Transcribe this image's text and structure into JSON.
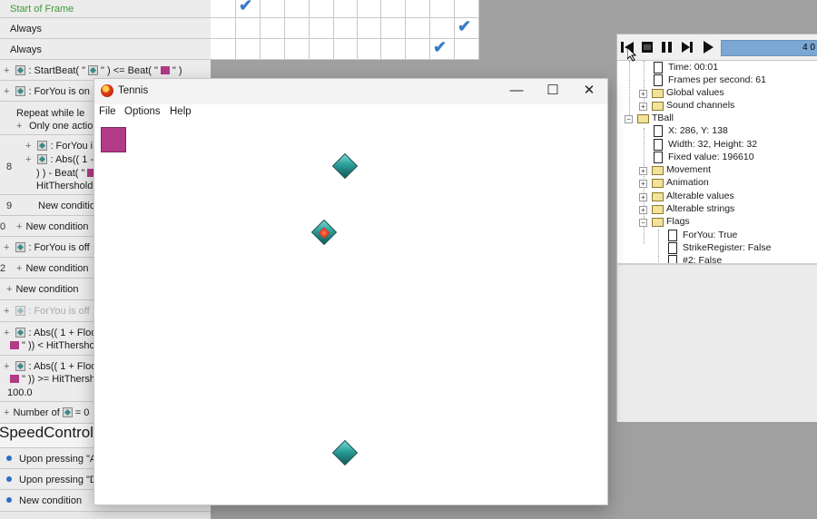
{
  "editor": {
    "rows": [
      {
        "num": "",
        "parts": [
          "Start of Frame"
        ],
        "style": "green"
      },
      {
        "num": "",
        "parts": [
          "Always"
        ]
      },
      {
        "num": "",
        "parts": [
          "Always"
        ]
      },
      {
        "num": "",
        "parts": [
          ": StartBeat( \"",
          "\" ) <= Beat( \"",
          "\" )"
        ]
      },
      {
        "num": "",
        "parts": [
          ": ForYou is on"
        ]
      },
      {
        "num": "",
        "parts": [
          "Repeat while le",
          "Only one actio"
        ]
      },
      {
        "num": "8",
        "parts": [
          ": ForYou i",
          ": Abs(( 1 -",
          ") ) - Beat( \"",
          "HitThershold"
        ]
      },
      {
        "num": "9",
        "parts": [
          "New condition"
        ]
      },
      {
        "num": "0",
        "parts": [
          "New condition"
        ]
      },
      {
        "num": "",
        "parts": [
          ": ForYou is off"
        ]
      },
      {
        "num": "2",
        "parts": [
          "New condition"
        ]
      },
      {
        "num": "",
        "parts": [
          "New condition"
        ]
      },
      {
        "num": "",
        "parts": [
          ": ForYou is off"
        ]
      },
      {
        "num": "",
        "parts": [
          ": Abs(( 1 + Floor",
          "\" )) < HitThersho"
        ]
      },
      {
        "num": "",
        "parts": [
          ": Abs(( 1 + Floor",
          "\" )) >= HitThersh",
          "100.0"
        ]
      },
      {
        "num": "",
        "parts": [
          "Number of",
          "= 0"
        ]
      },
      {
        "num": "",
        "parts": [
          "SpeedControl"
        ]
      },
      {
        "num": "",
        "parts": [
          "Upon pressing \"A"
        ]
      },
      {
        "num": "",
        "parts": [
          "Upon pressing \"D"
        ]
      },
      {
        "num": "",
        "parts": [
          "New condition"
        ]
      }
    ]
  },
  "debugger": {
    "progress_text": "4 0",
    "tree": [
      {
        "label": "Time: 00:01"
      },
      {
        "label": "Frames per second: 61"
      },
      {
        "label": "Global values"
      },
      {
        "label": "Sound channels"
      },
      {
        "label": "TBall"
      },
      {
        "label": "X: 286, Y: 138"
      },
      {
        "label": "Width: 32, Height: 32"
      },
      {
        "label": "Fixed value: 196610"
      },
      {
        "label": "Movement"
      },
      {
        "label": "Animation"
      },
      {
        "label": "Alterable values"
      },
      {
        "label": "Alterable strings"
      },
      {
        "label": "Flags"
      },
      {
        "label": "ForYou: True"
      },
      {
        "label": "StrikeRegister: False"
      },
      {
        "label": "#2: False"
      }
    ]
  },
  "tennis": {
    "title": "Tennis",
    "menu": [
      "File",
      "Options",
      "Help"
    ],
    "window_buttons": {
      "minimize": "—",
      "maximize": "☐",
      "close": "✕"
    }
  }
}
